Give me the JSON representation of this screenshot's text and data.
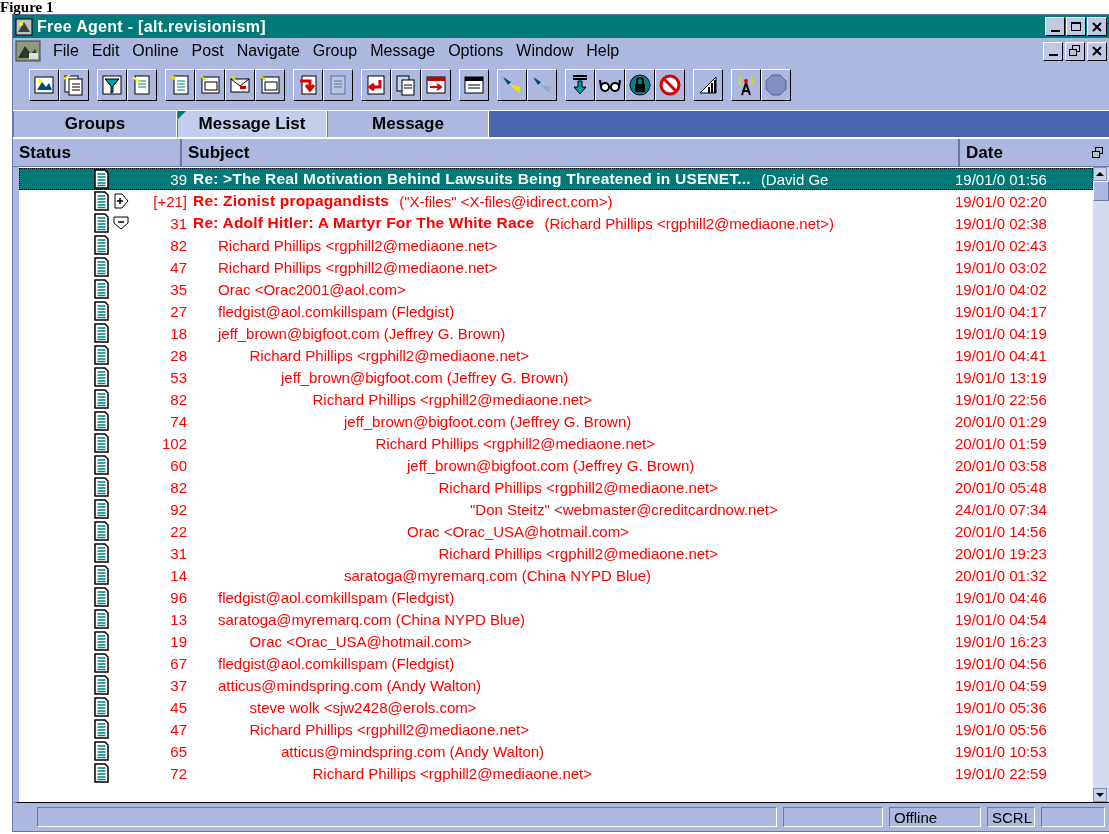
{
  "caption": "Figure 1",
  "window": {
    "title": "Free Agent - [alt.revisionism]"
  },
  "menu": [
    "File",
    "Edit",
    "Online",
    "Post",
    "Navigate",
    "Group",
    "Message",
    "Options",
    "Window",
    "Help"
  ],
  "tabs": [
    {
      "label": "Groups",
      "selected": false
    },
    {
      "label": "Message List",
      "selected": true
    },
    {
      "label": "Message",
      "selected": false
    }
  ],
  "columns": [
    "Status",
    "Subject",
    "Date"
  ],
  "threads": [
    {
      "kind": "single",
      "selected": true,
      "count": "39",
      "subject": "Re: >The Real Motivation Behind Lawsuits Being Threatened in USENET...",
      "author": "(David Ge",
      "date": "19/01/0 01:56"
    },
    {
      "kind": "thread",
      "expanded": false,
      "selected": false,
      "count": "[+21]",
      "subject": "Re: Zionist propagandists",
      "author": "(\"X-files\" <X-files@idirect.com>)",
      "date": "19/01/0 02:20"
    },
    {
      "kind": "thread",
      "expanded": true,
      "selected": false,
      "count": "31",
      "subject": "Re: Adolf Hitler: A Martyr For The White Race",
      "author": "(Richard Phillips <rgphill2@mediaone.net>)",
      "date": "19/01/0 02:38",
      "children": [
        {
          "count": "82",
          "author": "Richard Phillips <rgphill2@mediaone.net>",
          "date": "19/01/0 02:43",
          "selected": false
        },
        {
          "count": "47",
          "author": "Richard Phillips <rgphill2@mediaone.net>",
          "date": "19/01/0 03:02",
          "selected": false
        },
        {
          "count": "35",
          "author": "Orac <Orac2001@aol.com>",
          "date": "19/01/0 04:02",
          "selected": false
        },
        {
          "count": "27",
          "author": "fledgist@aol.comkillspam (Fledgist)",
          "date": "19/01/0 04:17",
          "selected": false
        },
        {
          "count": "18",
          "author": "jeff_brown@bigfoot.com (Jeffrey G. Brown)",
          "date": "19/01/0 04:19",
          "selected": false,
          "children": [
            {
              "count": "28",
              "author": "Richard Phillips <rgphill2@mediaone.net>",
              "date": "19/01/0 04:41",
              "selected": false,
              "children": [
                {
                  "count": "53",
                  "author": "jeff_brown@bigfoot.com (Jeffrey G. Brown)",
                  "date": "19/01/0 13:19",
                  "selected": false,
                  "children": [
                    {
                      "count": "82",
                      "author": "Richard Phillips <rgphill2@mediaone.net>",
                      "date": "19/01/0 22:56",
                      "selected": false,
                      "children": [
                        {
                          "count": "74",
                          "author": "jeff_brown@bigfoot.com (Jeffrey G. Brown)",
                          "date": "20/01/0 01:29",
                          "selected": false,
                          "children": [
                            {
                              "count": "102",
                              "author": "Richard Phillips <rgphill2@mediaone.net>",
                              "date": "20/01/0 01:59",
                              "selected": false,
                              "children": [
                                {
                                  "count": "60",
                                  "author": "jeff_brown@bigfoot.com (Jeffrey G. Brown)",
                                  "date": "20/01/0 03:58",
                                  "selected": false,
                                  "children": [
                                    {
                                      "count": "82",
                                      "author": "Richard Phillips <rgphill2@mediaone.net>",
                                      "date": "20/01/0 05:48",
                                      "selected": false,
                                      "children": [
                                        {
                                          "count": "92",
                                          "author": "\"Don Steitz\" <webmaster@creditcardnow.net>",
                                          "date": "24/01/0 07:34",
                                          "selected": false
                                        }
                                      ]
                                    }
                                  ]
                                },
                                {
                                  "count": "22",
                                  "author": "Orac <Orac_USA@hotmail.com>",
                                  "date": "20/01/0 14:56",
                                  "selected": false,
                                  "children": [
                                    {
                                      "count": "31",
                                      "author": "Richard Phillips <rgphill2@mediaone.net>",
                                      "date": "20/01/0 19:23",
                                      "selected": false
                                    }
                                  ]
                                }
                              ]
                            }
                          ]
                        },
                        {
                          "count": "14",
                          "author": "saratoga@myremarq.com (China NYPD Blue)",
                          "date": "20/01/0 01:32",
                          "selected": false
                        }
                      ]
                    }
                  ]
                }
              ]
            }
          ]
        },
        {
          "count": "96",
          "author": "fledgist@aol.comkillspam (Fledgist)",
          "date": "19/01/0 04:46",
          "selected": false
        },
        {
          "count": "13",
          "author": "saratoga@myremarq.com (China NYPD Blue)",
          "date": "19/01/0 04:54",
          "selected": false,
          "children": [
            {
              "count": "19",
              "author": "Orac <Orac_USA@hotmail.com>",
              "date": "19/01/0 16:23",
              "selected": false
            }
          ]
        },
        {
          "count": "67",
          "author": "fledgist@aol.comkillspam (Fledgist)",
          "date": "19/01/0 04:56",
          "selected": false
        },
        {
          "count": "37",
          "author": "atticus@mindspring.com (Andy Walton)",
          "date": "19/01/0 04:59",
          "selected": false,
          "children": [
            {
              "count": "45",
              "author": "steve wolk <sjw2428@erols.com>",
              "date": "19/01/0 05:36",
              "selected": false
            },
            {
              "count": "47",
              "author": "Richard Phillips <rgphill2@mediaone.net>",
              "date": "19/01/0 05:56",
              "selected": false,
              "children": [
                {
                  "count": "65",
                  "author": "atticus@mindspring.com (Andy Walton)",
                  "date": "19/01/0 10:53",
                  "selected": false,
                  "children": [
                    {
                      "count": "72",
                      "author": "Richard Phillips <rgphill2@mediaone.net>",
                      "date": "19/01/0 22:59",
                      "selected": false
                    }
                  ]
                }
              ]
            }
          ]
        }
      ]
    }
  ],
  "status_bar": {
    "connection": "Offline",
    "scroll_lock": "SCRL"
  }
}
